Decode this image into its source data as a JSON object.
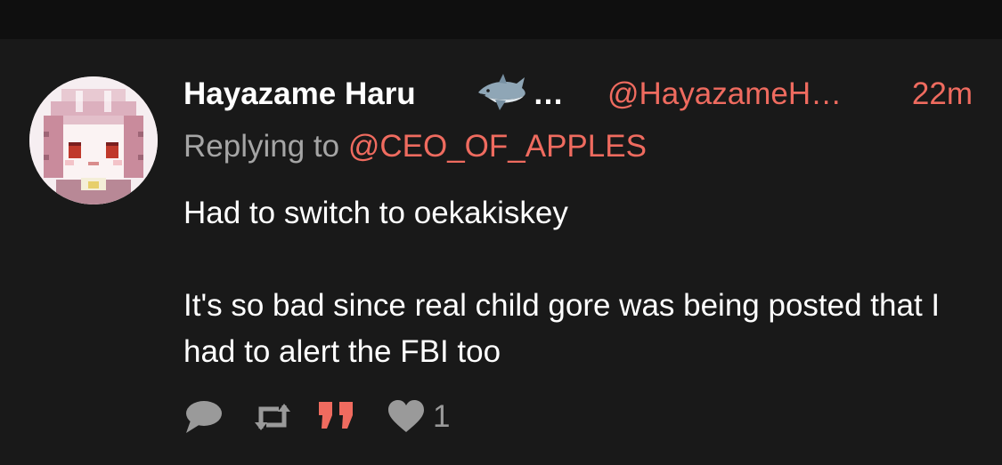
{
  "tweet": {
    "display_name": "Hayazame Haru",
    "name_emoji": "shark-icon",
    "name_ellipsis": "…",
    "handle": "@HayazameH…",
    "time": "22m",
    "reply_prefix": "Replying to ",
    "reply_target": "@CEO_OF_APPLES",
    "body": "Had to switch to oekakiskey\n\nIt's so bad since real child gore was being posted that I had to alert the FBI too",
    "actions": {
      "reply_icon": "speech-bubble-icon",
      "retweet_icon": "retweet-icon",
      "quote_icon": "quote-icon",
      "like_icon": "heart-icon",
      "like_count": "1"
    }
  },
  "colors": {
    "background": "#191919",
    "top_bar": "#0f0f0f",
    "accent": "#ef6b5f",
    "text": "#ffffff",
    "muted": "#a5a5a5",
    "icon": "#9a9a9a"
  }
}
